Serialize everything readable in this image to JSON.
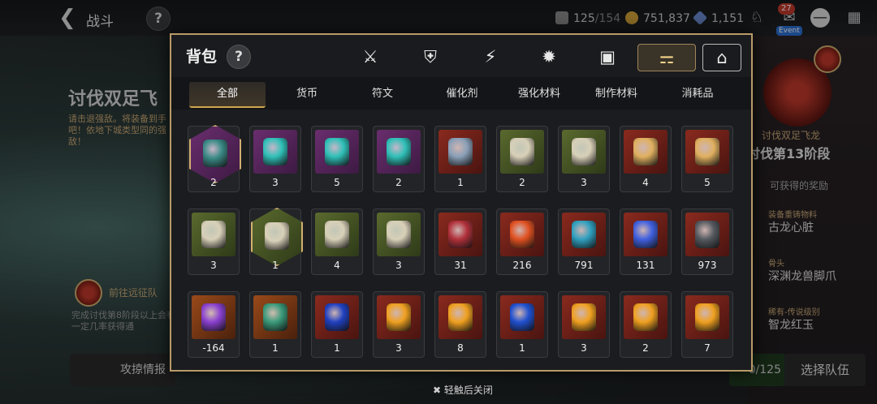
{
  "topbar": {
    "title": "战斗",
    "stamina": "125",
    "stamina_max": "/154",
    "gold": "751,837",
    "crystal": "1,151",
    "mail_badge": "27",
    "event_tag": "Event"
  },
  "background_left": {
    "title": "讨伐双足飞",
    "desc": "请击退强敌。将装备到手吧！依地下城类型同的强敌！",
    "expedition": "前往远征队",
    "desc2": "完成讨伐第8阶段以上会有一定几率获得通",
    "intel_button": "攻掠情报"
  },
  "background_right": {
    "boss_name": "讨伐双足飞龙",
    "stage": "讨伐第13阶段",
    "reward_label": "可获得的奖励",
    "items": [
      {
        "category": "装备重铸物料",
        "name": "古龙心脏"
      },
      {
        "category": "骨头",
        "name": "深渊龙兽脚爪"
      },
      {
        "category": "稀有-传说级别",
        "name": "智龙红玉"
      }
    ],
    "party_count": "0/125",
    "select_party": "选择队伍"
  },
  "modal": {
    "title": "背包",
    "category_icons": [
      "sword-shield-icon",
      "broken-shield-icon",
      "lightning-icon",
      "burst-icon",
      "dice-box-icon",
      "bag-icon",
      "house-icon"
    ],
    "active_category": 5,
    "tabs": [
      "全部",
      "货币",
      "符文",
      "催化剂",
      "强化材料",
      "制作材料",
      "消耗品"
    ],
    "active_tab": 0,
    "close_hint": "轻触后关闭"
  },
  "items": [
    {
      "count": "2",
      "frame": "purple",
      "gem": "#3a8a86",
      "hex": true
    },
    {
      "count": "3",
      "frame": "purple",
      "gem": "#2fc0b8"
    },
    {
      "count": "5",
      "frame": "purple",
      "gem": "#2fc0b8"
    },
    {
      "count": "2",
      "frame": "purple",
      "gem": "#2fc0b8"
    },
    {
      "count": "1",
      "frame": "red",
      "gem": "#8aa0b8"
    },
    {
      "count": "2",
      "frame": "green",
      "gem": "#d8d0b8"
    },
    {
      "count": "3",
      "frame": "green",
      "gem": "#d8d0b8"
    },
    {
      "count": "4",
      "frame": "red",
      "gem": "#e0b060"
    },
    {
      "count": "5",
      "frame": "red",
      "gem": "#e0b060"
    },
    {
      "count": "3",
      "frame": "green",
      "gem": "#d8d0b8"
    },
    {
      "count": "1",
      "frame": "green",
      "gem": "#d8d0b8",
      "hex": true
    },
    {
      "count": "4",
      "frame": "green",
      "gem": "#d8d0b8"
    },
    {
      "count": "3",
      "frame": "green",
      "gem": "#d8d0b8"
    },
    {
      "count": "31",
      "frame": "red",
      "gem": "#b0303a"
    },
    {
      "count": "216",
      "frame": "red",
      "gem": "#e05020"
    },
    {
      "count": "791",
      "frame": "red",
      "gem": "#30a0c0"
    },
    {
      "count": "131",
      "frame": "red",
      "gem": "#4060e0"
    },
    {
      "count": "973",
      "frame": "red",
      "gem": "#555a60"
    },
    {
      "count": "-164",
      "frame": "orange",
      "gem": "#8a40d0"
    },
    {
      "count": "1",
      "frame": "orange",
      "gem": "#3a9a7a"
    },
    {
      "count": "1",
      "frame": "red",
      "gem": "#2040c0"
    },
    {
      "count": "3",
      "frame": "red",
      "gem": "#f0a020"
    },
    {
      "count": "8",
      "frame": "red",
      "gem": "#f0a020"
    },
    {
      "count": "1",
      "frame": "red",
      "gem": "#2050d0"
    },
    {
      "count": "3",
      "frame": "red",
      "gem": "#f0a020"
    },
    {
      "count": "2",
      "frame": "red",
      "gem": "#f0a020"
    },
    {
      "count": "7",
      "frame": "red",
      "gem": "#f0a020"
    }
  ]
}
